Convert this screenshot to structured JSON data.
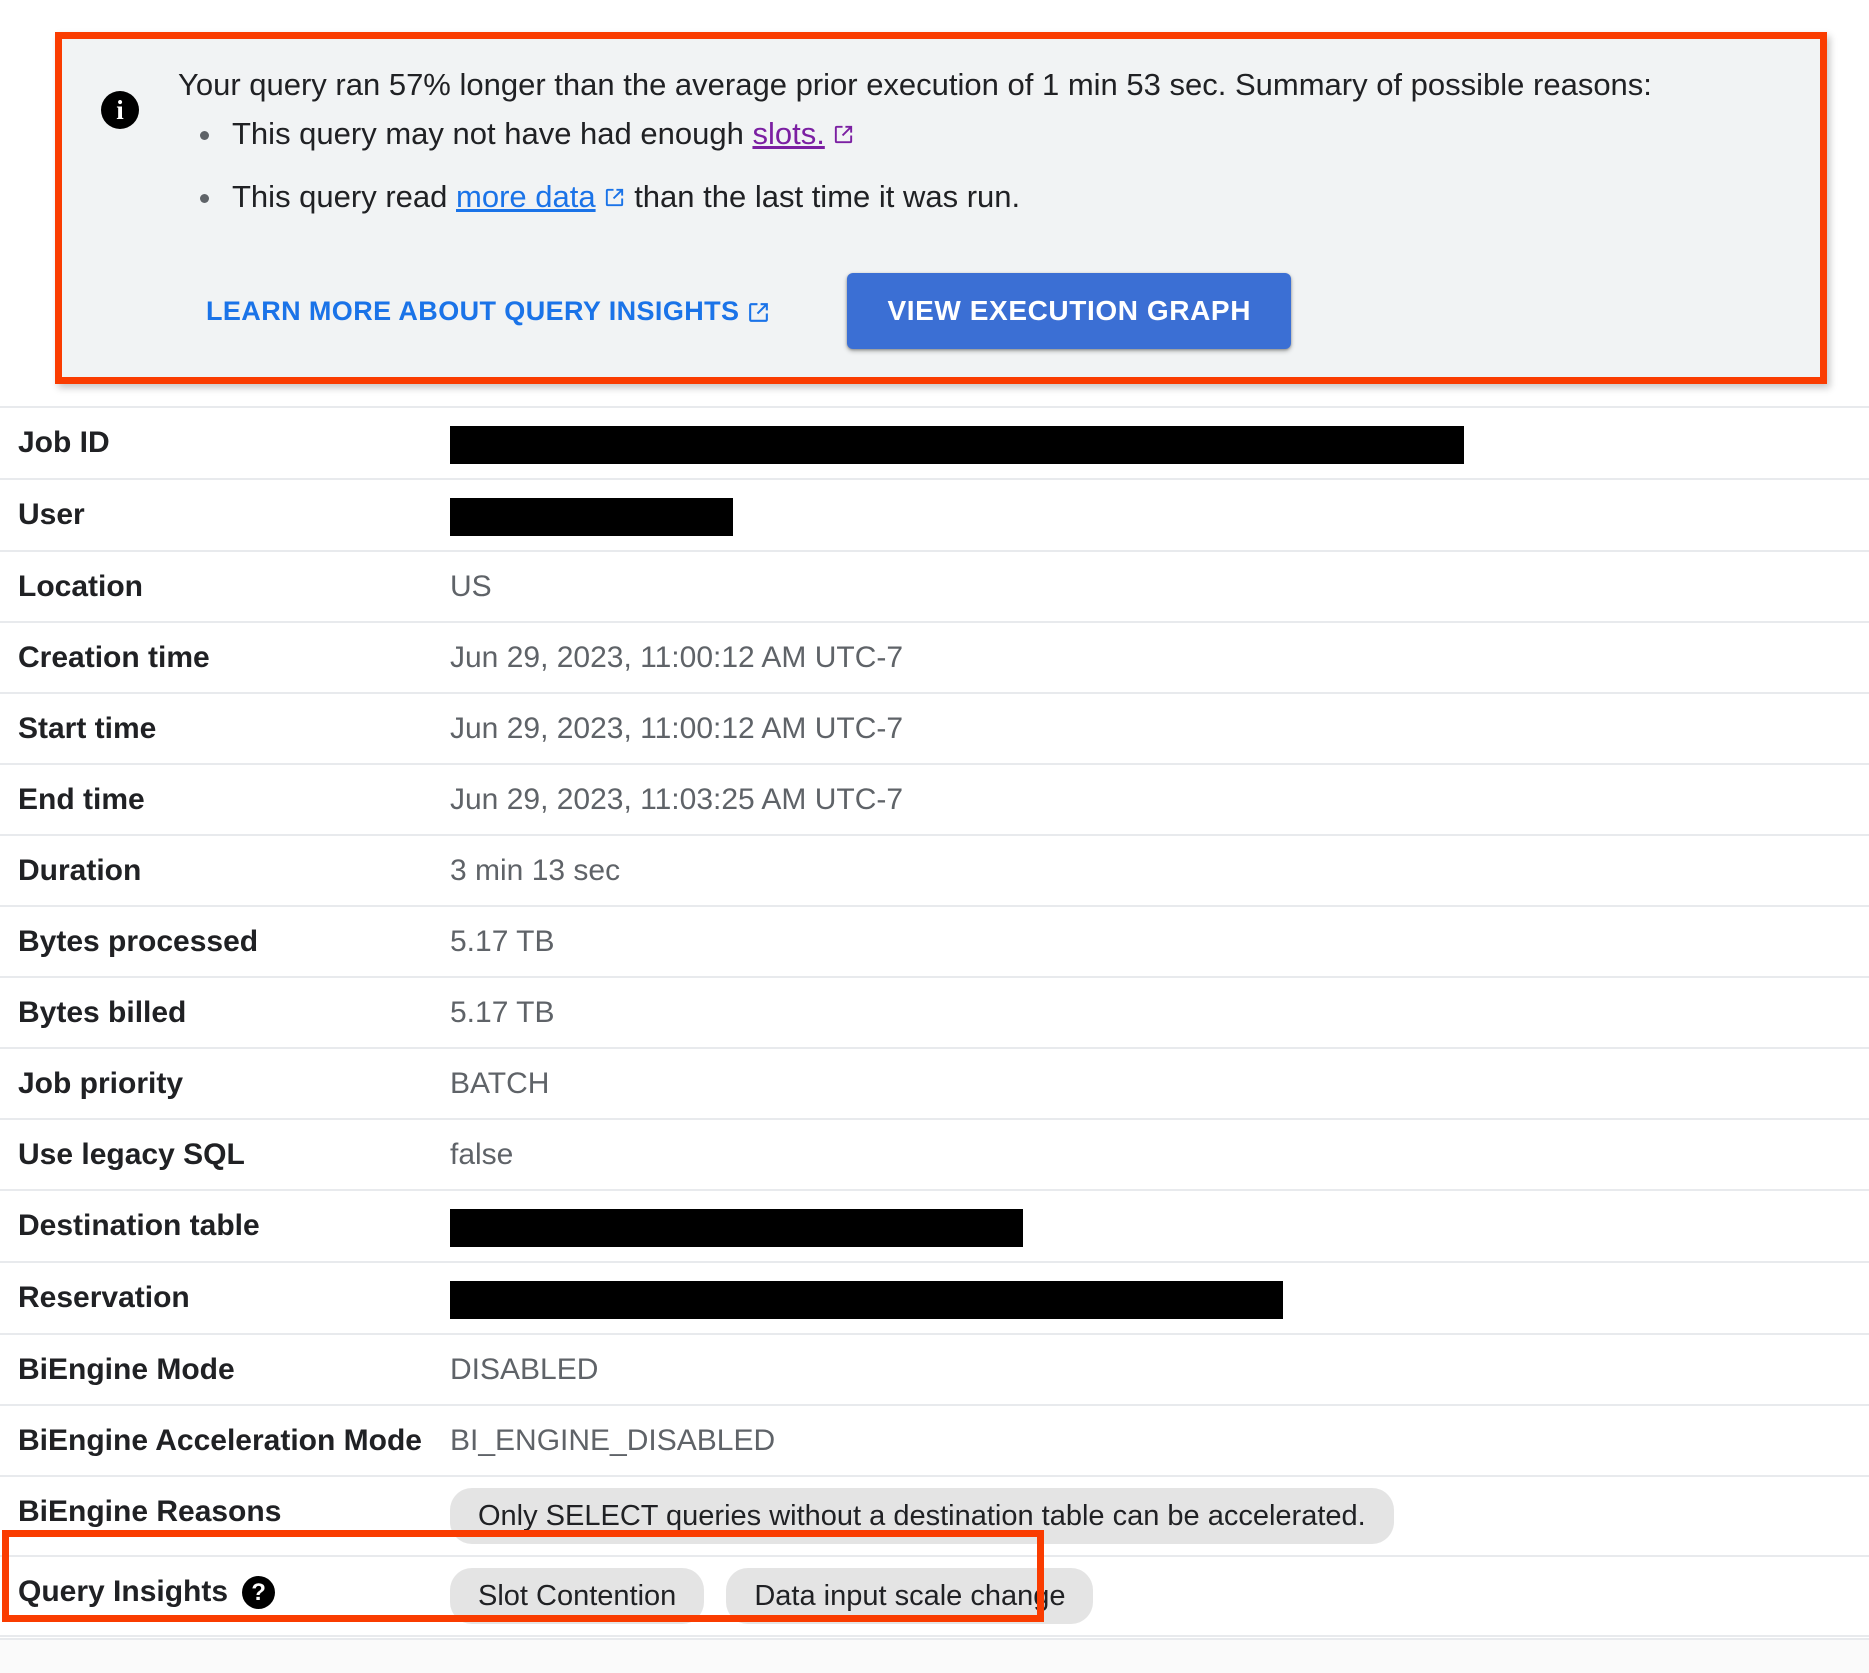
{
  "banner": {
    "icon": "info-icon",
    "headline": "Your query ran 57% longer than the average prior execution of 1 min 53 sec. Summary of possible reasons:",
    "bullets": [
      {
        "prefix": "This query may not have had enough ",
        "link_text": "slots.",
        "link_style": "visited",
        "suffix": ""
      },
      {
        "prefix": "This query read ",
        "link_text": "more data",
        "link_style": "blue",
        "suffix": " than the last time it was run."
      }
    ],
    "learn_more_label": "LEARN MORE ABOUT QUERY INSIGHTS",
    "view_graph_label": "VIEW EXECUTION GRAPH",
    "highlight_color": "#fa3c00",
    "button_color": "#3b6fd4",
    "link_color": "#1a73e8",
    "visited_link_color": "#7b1fa2"
  },
  "details": {
    "rows": [
      {
        "label": "Job ID",
        "value": "",
        "redacted_width": 1014
      },
      {
        "label": "User",
        "value": "",
        "redacted_width": 283
      },
      {
        "label": "Location",
        "value": "US"
      },
      {
        "label": "Creation time",
        "value": "Jun 29, 2023, 11:00:12 AM UTC-7"
      },
      {
        "label": "Start time",
        "value": "Jun 29, 2023, 11:00:12 AM UTC-7"
      },
      {
        "label": "End time",
        "value": "Jun 29, 2023, 11:03:25 AM UTC-7"
      },
      {
        "label": "Duration",
        "value": "3 min 13 sec"
      },
      {
        "label": "Bytes processed",
        "value": "5.17 TB"
      },
      {
        "label": "Bytes billed",
        "value": "5.17 TB"
      },
      {
        "label": "Job priority",
        "value": "BATCH"
      },
      {
        "label": "Use legacy SQL",
        "value": "false"
      },
      {
        "label": "Destination table",
        "value": "",
        "redacted_width": 573
      },
      {
        "label": "Reservation",
        "value": "",
        "redacted_width": 833
      },
      {
        "label": "BiEngine Mode",
        "value": "DISABLED"
      },
      {
        "label": "BiEngine Acceleration Mode",
        "value": "BI_ENGINE_DISABLED"
      },
      {
        "label": "BiEngine Reasons",
        "chips": [
          "Only SELECT queries without a destination table can be accelerated."
        ]
      }
    ],
    "query_insights": {
      "label": "Query Insights",
      "help_icon": "help-icon",
      "chips": [
        "Slot Contention",
        "Data input scale change"
      ]
    }
  }
}
